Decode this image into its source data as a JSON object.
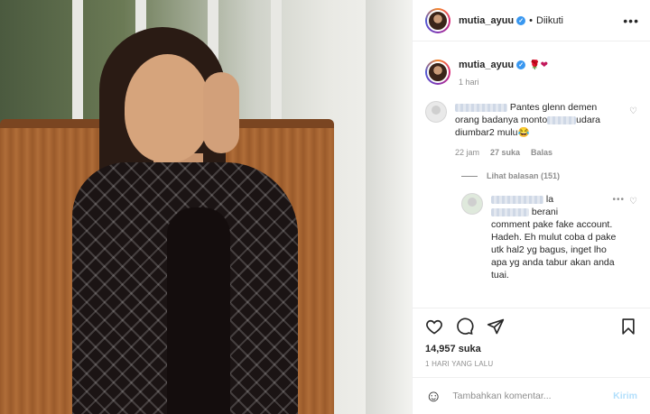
{
  "post": {
    "author": "mutia_ayuu",
    "follow_state": "Diikuti",
    "separator": "•",
    "more_label": "•••"
  },
  "caption": {
    "username": "mutia_ayuu",
    "emoji": "🌹❤",
    "time": "1 hari"
  },
  "comments": [
    {
      "text_visible_1": "Pantes glenn demen",
      "text_visible_2": "orang badanya monto",
      "text_visible_3": "udara",
      "text_visible_4": "diumbar2 mulu😂",
      "time": "22 jam",
      "likes": "27 suka",
      "reply_label": "Balas",
      "view_replies": "Lihat balasan (151)"
    }
  ],
  "reply": {
    "visible_frag_1": "la",
    "visible_frag_2": "berani",
    "visible_frag_3": "comment pake fake account. Hadeh. Eh mulut coba d pake utk hal2 yg bagus, inget lho apa yg anda tabur akan anda tuai.",
    "dots": "•••"
  },
  "stats": {
    "likes": "14,957 suka",
    "date": "1 HARI YANG LALU"
  },
  "composer": {
    "placeholder": "Tambahkan komentar...",
    "post_label": "Kirim",
    "emoji_icon": "☺"
  }
}
